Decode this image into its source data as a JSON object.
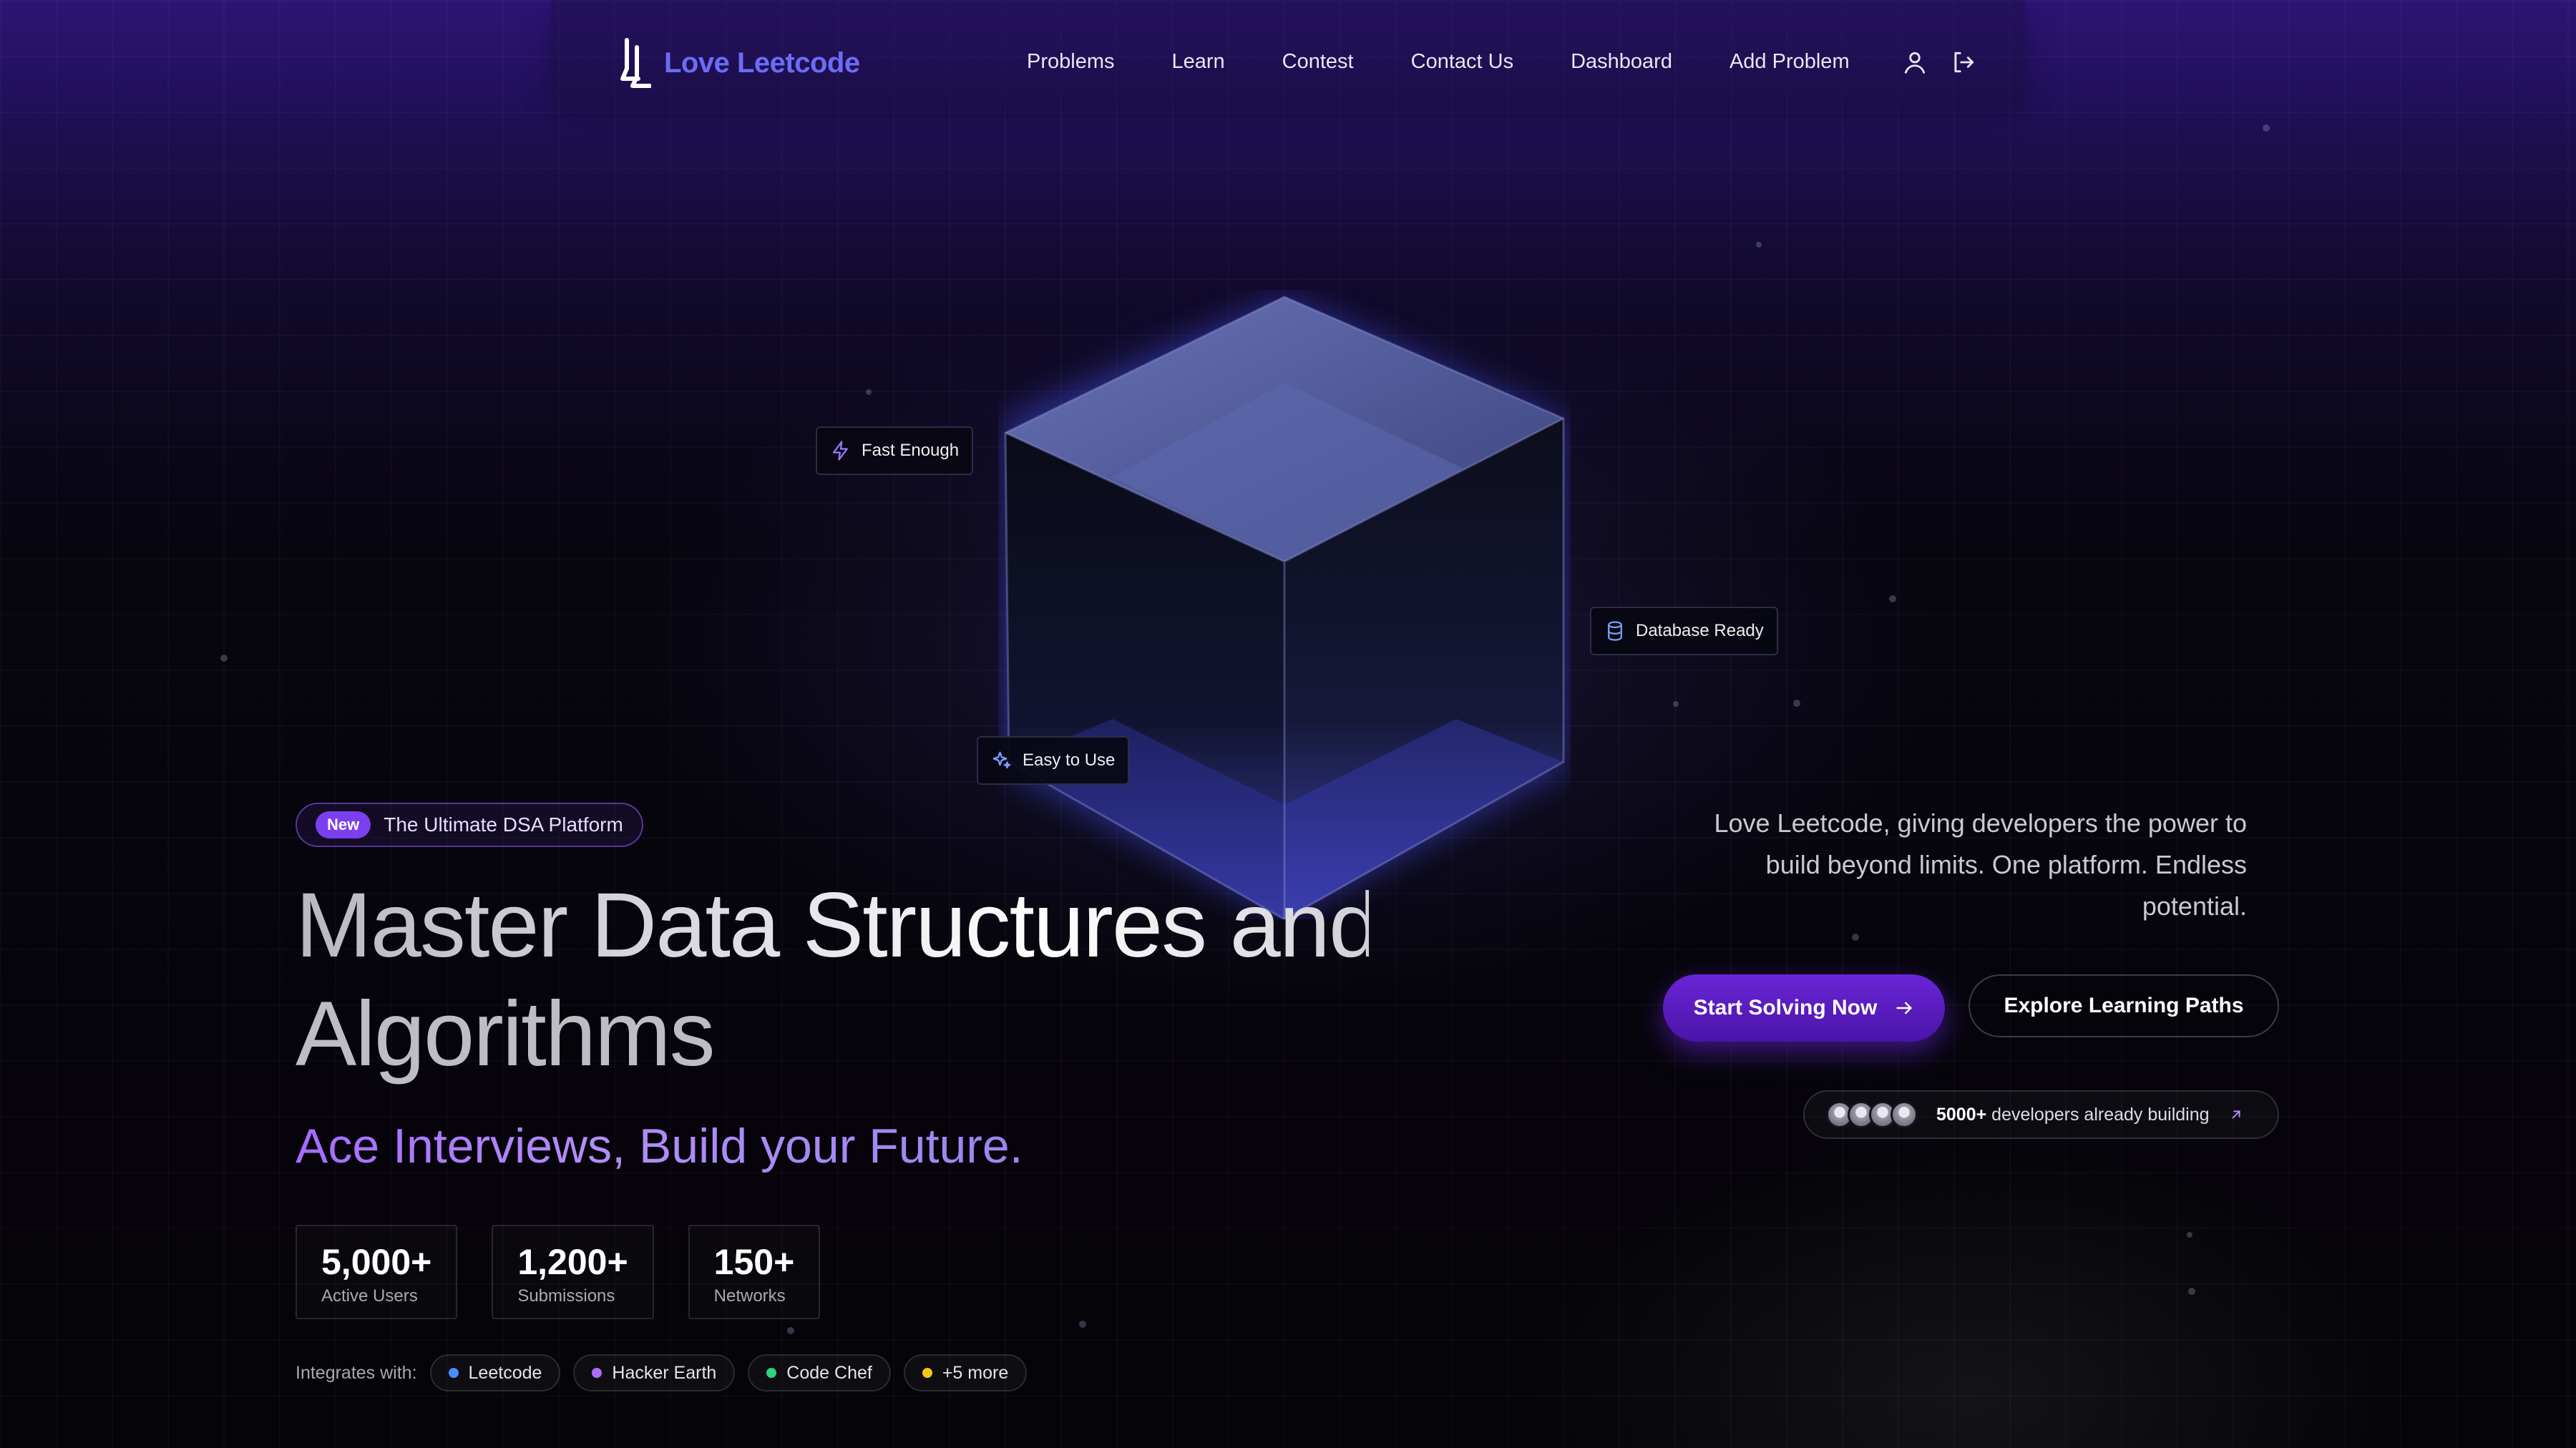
{
  "nav": {
    "brand": "Love Leetcode",
    "items": [
      "Problems",
      "Learn",
      "Contest",
      "Contact Us",
      "Dashboard",
      "Add Problem"
    ],
    "icons": [
      "user-icon",
      "logout-icon"
    ]
  },
  "floating_tags": {
    "fast": "Fast Enough",
    "database": "Database Ready",
    "easy": "Easy to Use"
  },
  "hero": {
    "badge_new": "New",
    "badge_text": "The Ultimate DSA Platform",
    "title_line1": "Master Data Structures and",
    "title_line2": "Algorithms",
    "subtitle": "Ace Interviews, Build your Future.",
    "stats": [
      {
        "value": "5,000+",
        "label": "Active Users"
      },
      {
        "value": "1,200+",
        "label": "Submissions"
      },
      {
        "value": "150+",
        "label": "Networks"
      }
    ],
    "integrates_label": "Integrates with:",
    "integrations": [
      {
        "name": "Leetcode",
        "color": "#4a8cff"
      },
      {
        "name": "Hacker Earth",
        "color": "#b06cff"
      },
      {
        "name": "Code Chef",
        "color": "#2ed37a"
      },
      {
        "name": "+5 more",
        "color": "#f5c518"
      }
    ]
  },
  "right": {
    "description": "Love Leetcode, giving developers the power to build beyond limits. One platform. Endless potential.",
    "primary_cta": "Start Solving Now",
    "secondary_cta": "Explore Learning Paths",
    "devs_count": "5000+",
    "devs_text": " developers already building"
  },
  "colors": {
    "brand": "#6c6cf5",
    "accent": "#7b3ff0"
  }
}
